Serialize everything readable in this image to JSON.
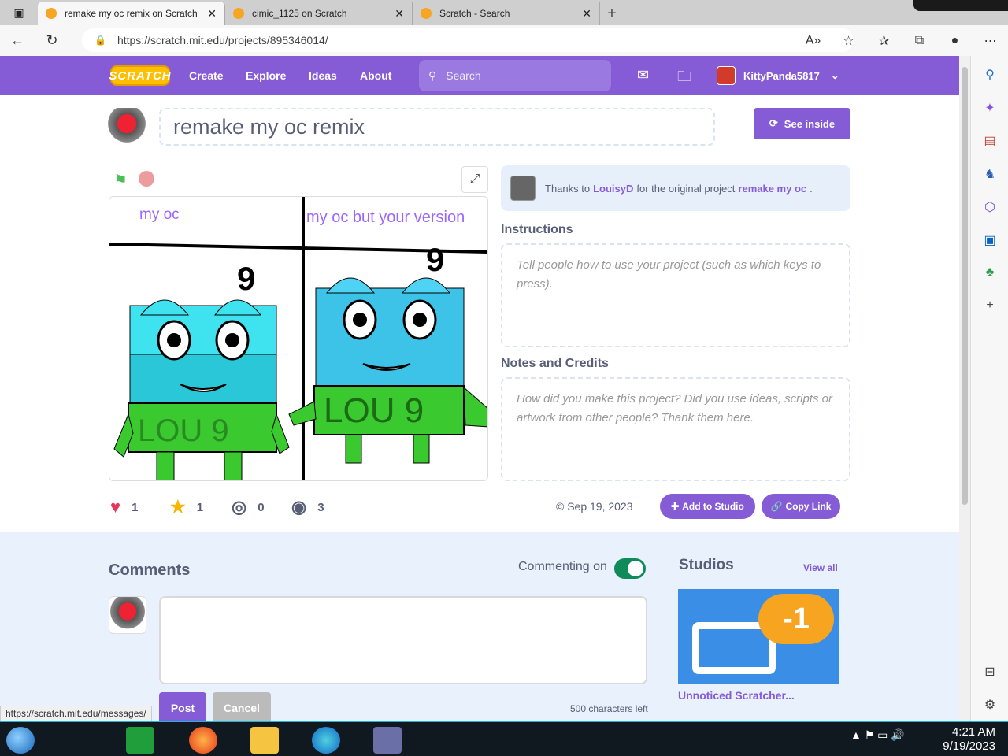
{
  "browser": {
    "tabs": [
      {
        "title": "remake my oc remix on Scratch",
        "active": true
      },
      {
        "title": "cimic_1125 on Scratch",
        "active": false
      },
      {
        "title": "Scratch - Search",
        "active": false
      }
    ],
    "url": "https://scratch.mit.edu/projects/895346014/",
    "status_url": "https://scratch.mit.edu/messages/"
  },
  "nav": {
    "logo": "SCRATCH",
    "links": [
      "Create",
      "Explore",
      "Ideas",
      "About"
    ],
    "search_placeholder": "Search",
    "username": "KittyPanda5817"
  },
  "project": {
    "title": "remake my oc remix",
    "see_inside": "See inside",
    "stage": {
      "label_left": "my oc",
      "label_right": "my oc but your version",
      "badge_left": "LOU 9",
      "badge_right": "LOU 9",
      "number_left": "9",
      "number_right": "9"
    },
    "credit": {
      "prefix": "Thanks to",
      "author": "LouisyD",
      "middle": "for the original project",
      "original": "remake my oc",
      "suffix": "."
    },
    "instructions_heading": "Instructions",
    "instructions_placeholder": "Tell people how to use your project (such as which keys to press).",
    "notes_heading": "Notes and Credits",
    "notes_placeholder": "How did you make this project? Did you use ideas, scripts or artwork from other people? Thank them here.",
    "stats": {
      "loves": "1",
      "favorites": "1",
      "remixes": "0",
      "views": "3"
    },
    "date": "© Sep 19, 2023",
    "add_to_studio": "Add to Studio",
    "copy_link": "Copy Link"
  },
  "comments": {
    "heading": "Comments",
    "commenting_on": "Commenting on",
    "post": "Post",
    "cancel": "Cancel",
    "chars_left": "500 characters left"
  },
  "studios": {
    "heading": "Studios",
    "view_all": "View all",
    "badge": "-1",
    "name": "Unnoticed Scratcher..."
  },
  "taskbar": {
    "time": "4:21 AM",
    "date": "9/19/2023"
  },
  "colors": {
    "scratch_purple": "#855cd6",
    "scratch_text": "#575e75",
    "lower_bg": "#e9f1fc"
  }
}
